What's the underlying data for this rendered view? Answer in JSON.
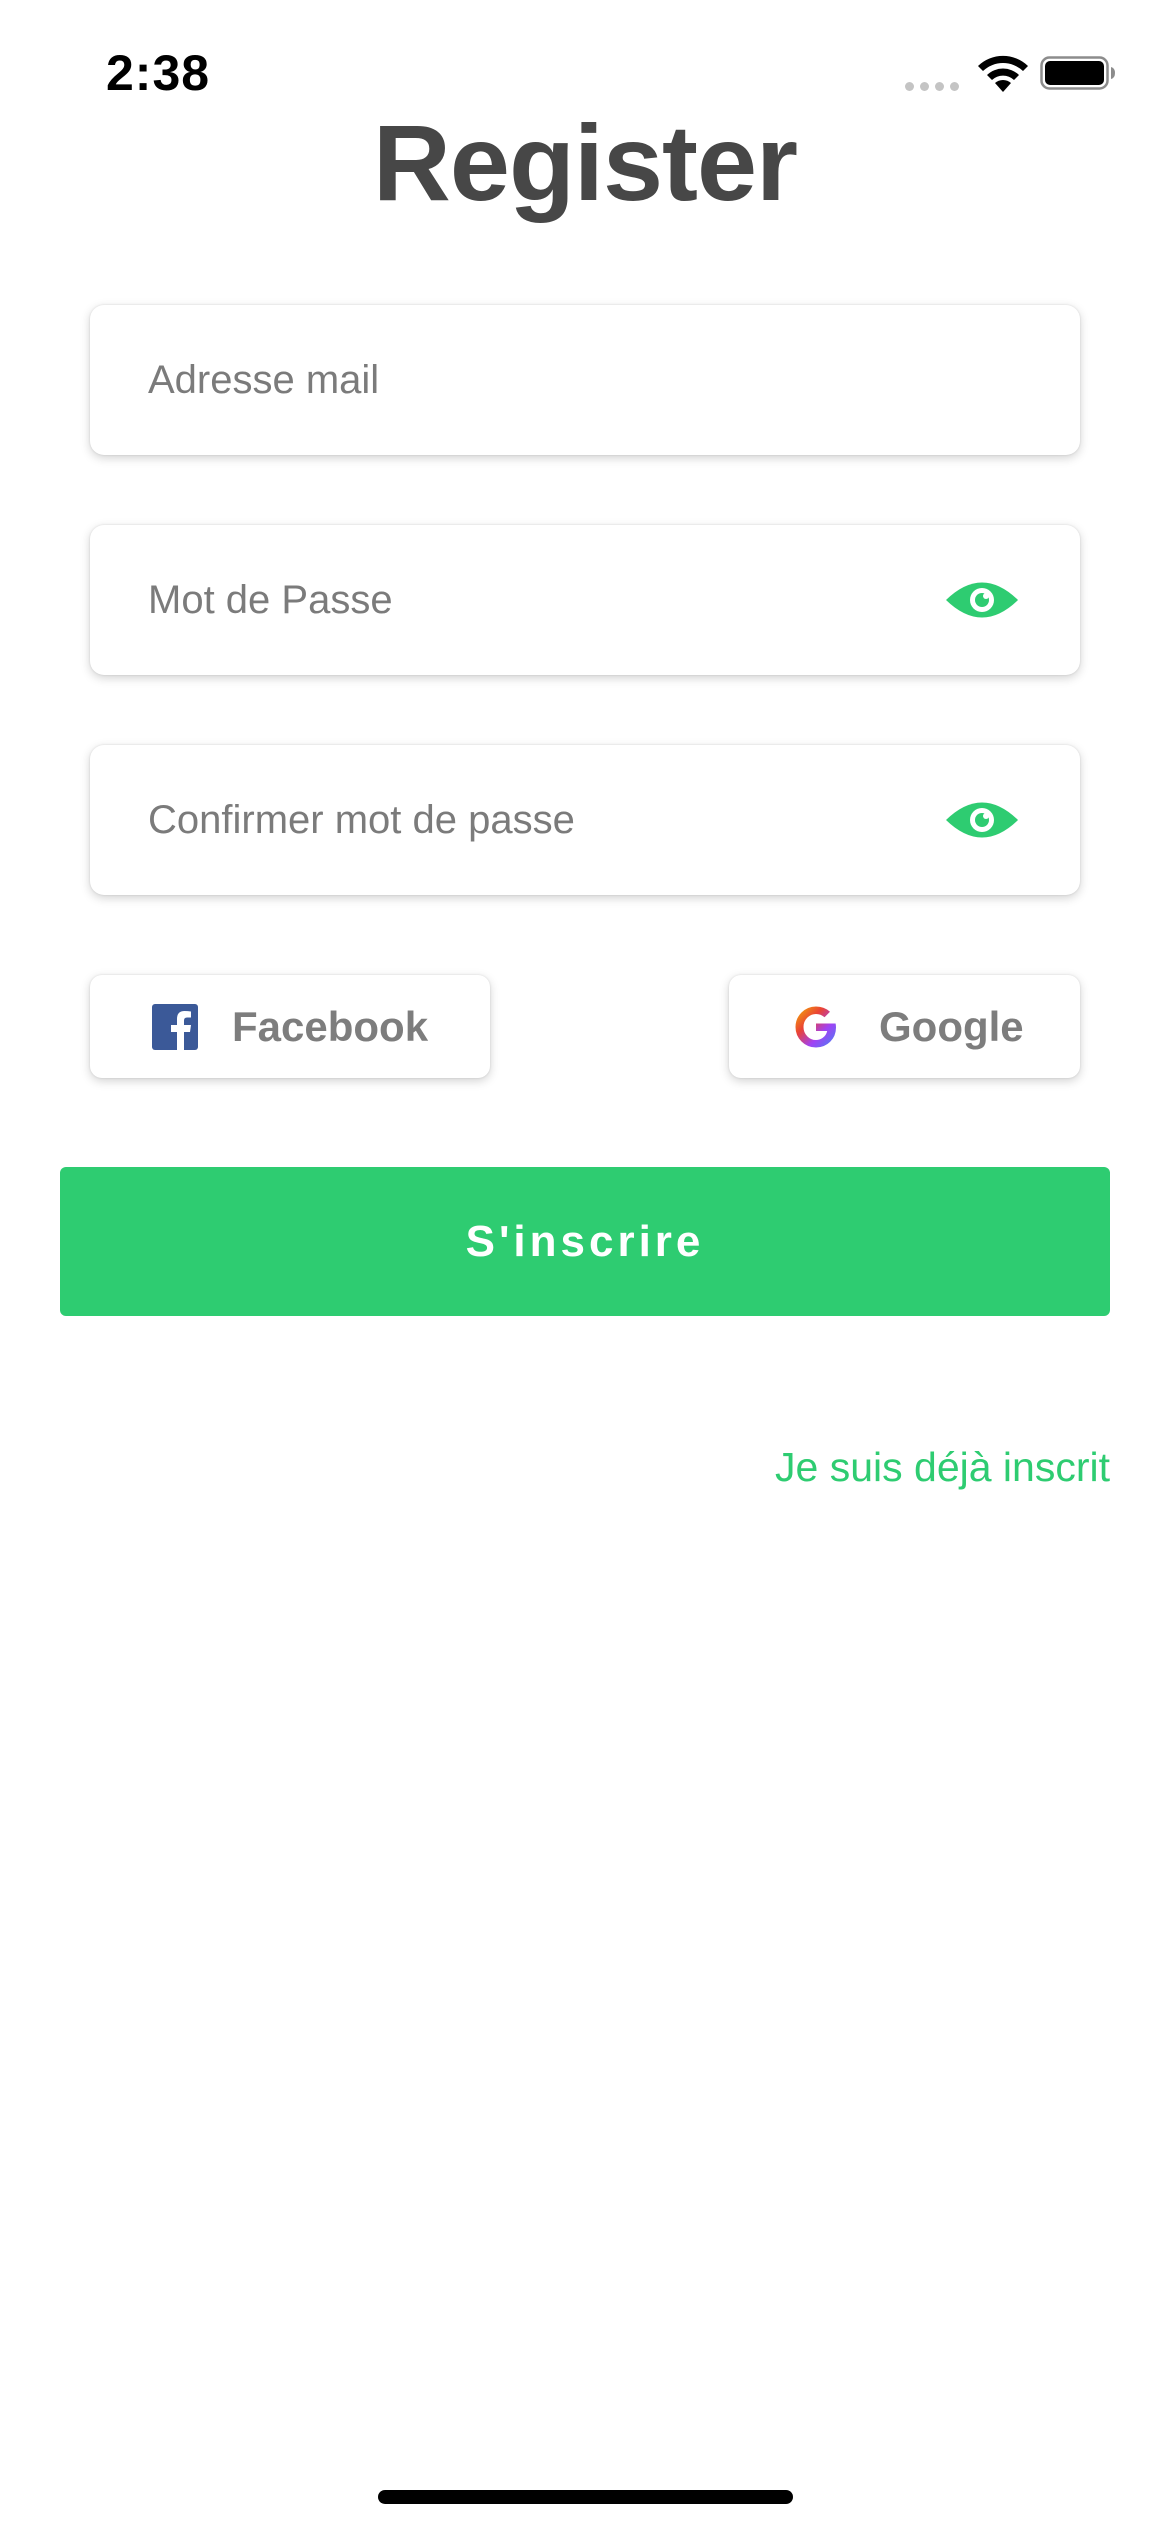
{
  "status_bar": {
    "time": "2:38"
  },
  "title": "Register",
  "fields": {
    "email_placeholder": "Adresse mail",
    "password_placeholder": "Mot de Passe",
    "confirm_password_placeholder": "Confirmer mot de passe",
    "email_value": "",
    "password_value": "",
    "confirm_password_value": ""
  },
  "social": {
    "facebook_label": "Facebook",
    "google_label": "Google"
  },
  "register_button_label": "S'inscrire",
  "login_link_label": "Je suis déjà inscrit",
  "icons": {
    "password_toggle": "eye-icon",
    "confirm_toggle": "eye-icon",
    "facebook": "facebook-icon",
    "google": "google-icon"
  },
  "colors": {
    "accent": "#2ecc71",
    "title": "#474747",
    "placeholder": "#7b7b7b",
    "facebook_brand": "#3b5998"
  }
}
